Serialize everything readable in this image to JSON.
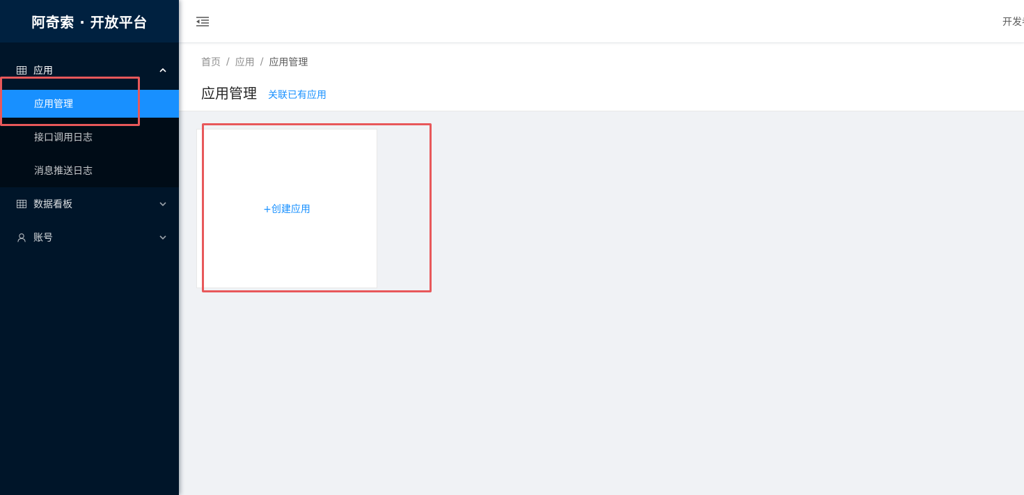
{
  "sidebar": {
    "logo": "阿奇索 · 开放平台",
    "menu": [
      {
        "label": "应用",
        "icon": "table-icon",
        "expanded": true,
        "children": [
          {
            "label": "应用管理",
            "active": true
          },
          {
            "label": "接口调用日志",
            "active": false
          },
          {
            "label": "消息推送日志",
            "active": false
          }
        ]
      },
      {
        "label": "数据看板",
        "icon": "table-icon",
        "expanded": false
      },
      {
        "label": "账号",
        "icon": "user-icon",
        "expanded": false
      }
    ]
  },
  "header": {
    "right_text": "开发者"
  },
  "breadcrumb": [
    "首页",
    "应用",
    "应用管理"
  ],
  "page": {
    "title": "应用管理",
    "link": "关联已有应用"
  },
  "content": {
    "create_card_label": "+创建应用"
  },
  "colors": {
    "sidebar_bg": "#001529",
    "logo_bg": "#002140",
    "submenu_bg": "#000c17",
    "primary": "#1890ff",
    "annotation": "#e8585a"
  }
}
